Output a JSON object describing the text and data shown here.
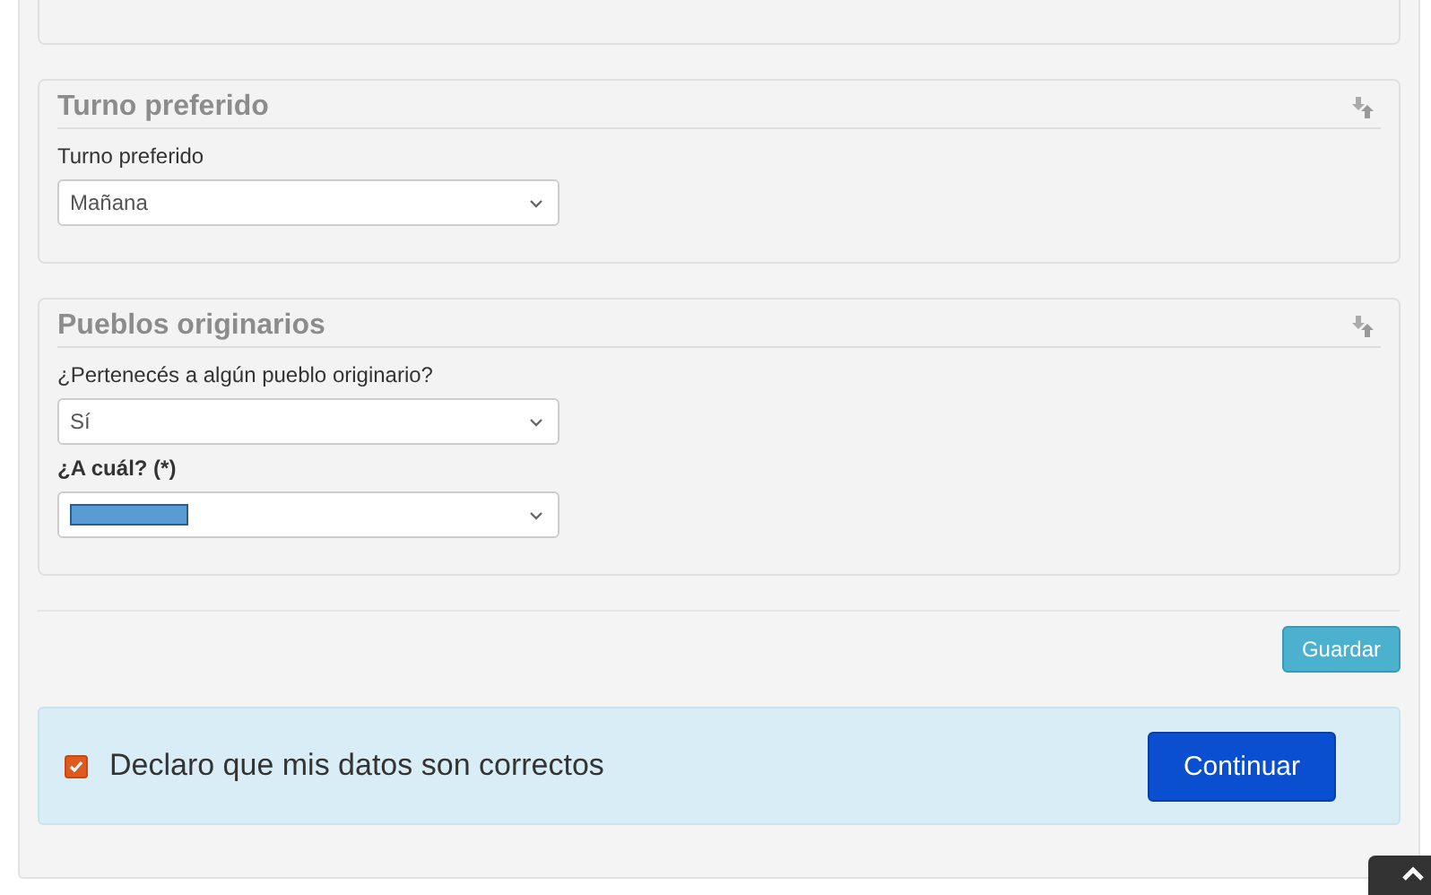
{
  "sections": [
    {
      "title": "Turno preferido",
      "fields": [
        {
          "label": "Turno preferido",
          "value": "Mañana",
          "required": false
        }
      ]
    },
    {
      "title": "Pueblos originarios",
      "fields": [
        {
          "label": "¿Pertenecés a algún pueblo originario?",
          "value": "Sí",
          "required": false
        },
        {
          "label": "¿A cuál? (*)",
          "redacted": true,
          "required": true
        }
      ]
    }
  ],
  "save_button": "Guardar",
  "declaration": {
    "label": "Declaro que mis datos son correctos",
    "checked": true
  },
  "continue_button": "Continuar"
}
